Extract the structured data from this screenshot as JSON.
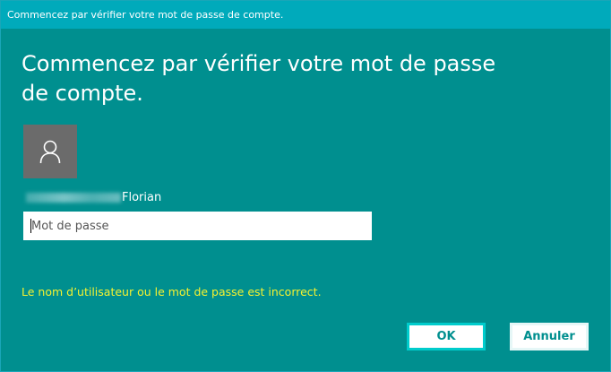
{
  "window": {
    "title": "Commencez par vérifier votre mot de passe de compte."
  },
  "main": {
    "heading": "Commencez par vérifier votre mot de passe de compte.",
    "avatar_icon": "user-icon",
    "username_suffix": "Florian",
    "password_placeholder": "Mot de passe",
    "password_value": "",
    "error_message": "Le nom d’utilisateur ou le mot de passe est incorrect."
  },
  "buttons": {
    "ok_label": "OK",
    "cancel_label": "Annuler"
  },
  "colors": {
    "background": "#008f8f",
    "titlebar": "#00aabb",
    "error": "#f5f230",
    "avatar_bg": "#6b6b6b"
  }
}
